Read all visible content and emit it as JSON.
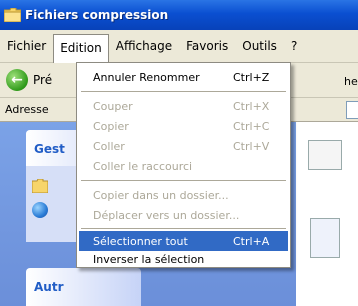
{
  "window": {
    "title": "Fichiers compression"
  },
  "menubar": {
    "items": [
      "Fichier",
      "Edition",
      "Affichage",
      "Favoris",
      "Outils",
      "?"
    ]
  },
  "toolbar": {
    "back_label": "Pré",
    "right_text": "her"
  },
  "addressbar": {
    "label": "Adresse"
  },
  "taskpane": {
    "panel1_title": "Gest",
    "panel2_title": "Autr"
  },
  "edit_menu": {
    "items": [
      {
        "label": "Annuler Renommer",
        "shortcut": "Ctrl+Z",
        "enabled": true
      },
      {
        "label": "Couper",
        "shortcut": "Ctrl+X",
        "enabled": false
      },
      {
        "label": "Copier",
        "shortcut": "Ctrl+C",
        "enabled": false
      },
      {
        "label": "Coller",
        "shortcut": "Ctrl+V",
        "enabled": false
      },
      {
        "label": "Coller le raccourci",
        "shortcut": "",
        "enabled": false
      },
      {
        "label": "Copier dans un dossier...",
        "shortcut": "",
        "enabled": false
      },
      {
        "label": "Déplacer vers un dossier...",
        "shortcut": "",
        "enabled": false
      },
      {
        "label": "Sélectionner tout",
        "shortcut": "Ctrl+A",
        "enabled": true,
        "highlighted": true
      },
      {
        "label": "Inverser la sélection",
        "shortcut": "",
        "enabled": true
      }
    ]
  },
  "colors": {
    "titlebar": "#0a4fd1",
    "menu_highlight": "#316ac5",
    "disabled_text": "#aca899",
    "taskpane": "#7ba2e7"
  }
}
